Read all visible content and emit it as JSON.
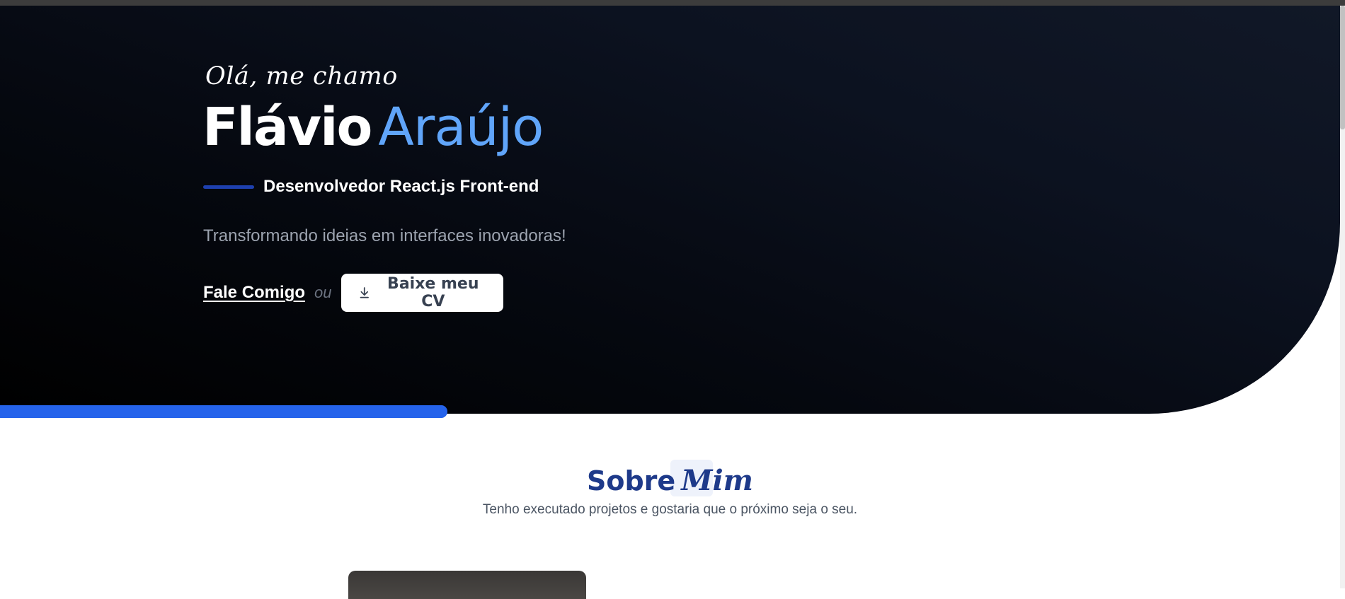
{
  "hero": {
    "greeting": "Olá, me chamo",
    "first_name": "Flávio",
    "last_name": "Araújo",
    "role": "Desenvolvedor React.js Front-end",
    "tagline": "Transformando ideias em interfaces inovadoras!",
    "contact_link": "Fale Comigo",
    "or_text": "ou",
    "cv_button": "Baixe meu CV",
    "cv_icon": "download-icon"
  },
  "about": {
    "title_bold": "Sobre",
    "title_script": "Mim",
    "subtitle": "Tenho executado projetos e gostaria que o próximo seja o seu."
  },
  "colors": {
    "accent_blue": "#60a5fa",
    "bar_blue": "#2563eb",
    "heading_navy": "#1e3a8a",
    "hero_bg": "#0b0f19"
  }
}
